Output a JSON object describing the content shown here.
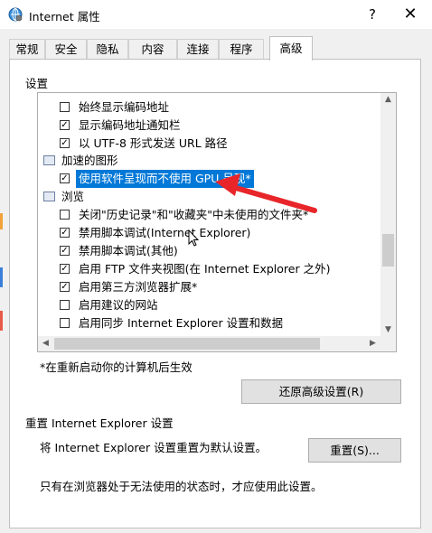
{
  "window": {
    "title": "Internet 属性",
    "help": "?",
    "close": "✕"
  },
  "tabs": [
    {
      "label": "常规"
    },
    {
      "label": "安全"
    },
    {
      "label": "隐私"
    },
    {
      "label": "内容"
    },
    {
      "label": "连接"
    },
    {
      "label": "程序"
    },
    {
      "label": "高级",
      "active": true
    }
  ],
  "settings": {
    "label": "设置",
    "rows": [
      {
        "label": "始终显示编码地址",
        "checked": false,
        "kind": "checkbox"
      },
      {
        "label": "显示编码地址通知栏",
        "checked": true,
        "kind": "checkbox"
      },
      {
        "label": "以 UTF-8 形式发送 URL 路径",
        "checked": true,
        "kind": "checkbox"
      },
      {
        "label": "加速的图形",
        "kind": "category"
      },
      {
        "label": "使用软件呈现而不使用 GPU 呈现*",
        "checked": true,
        "kind": "checkbox",
        "selected": true
      },
      {
        "label": "浏览",
        "kind": "category"
      },
      {
        "label": "关闭\"历史记录\"和\"收藏夹\"中未使用的文件夹*",
        "checked": false,
        "kind": "checkbox"
      },
      {
        "label": "禁用脚本调试(Internet Explorer)",
        "checked": true,
        "kind": "checkbox"
      },
      {
        "label": "禁用脚本调试(其他)",
        "checked": true,
        "kind": "checkbox"
      },
      {
        "label": "启用 FTP 文件夹视图(在 Internet Explorer 之外)",
        "checked": true,
        "kind": "checkbox"
      },
      {
        "label": "启用第三方浏览器扩展*",
        "checked": true,
        "kind": "checkbox"
      },
      {
        "label": "启用建议的网站",
        "checked": false,
        "kind": "checkbox"
      },
      {
        "label": "启用同步 Internet Explorer 设置和数据",
        "checked": false,
        "kind": "checkbox"
      }
    ],
    "restart_note": "*在重新启动你的计算机后生效",
    "restore_button": "还原高级设置(R)"
  },
  "reset": {
    "group_label": "重置 Internet Explorer 设置",
    "description": "将 Internet Explorer 设置重置为默认设置。",
    "button": "重置(S)...",
    "warning": "只有在浏览器处于无法使用的状态时，才应使用此设置。"
  },
  "colors": {
    "selection": "#0078d7",
    "annotation_arrow": "#e8262a"
  }
}
